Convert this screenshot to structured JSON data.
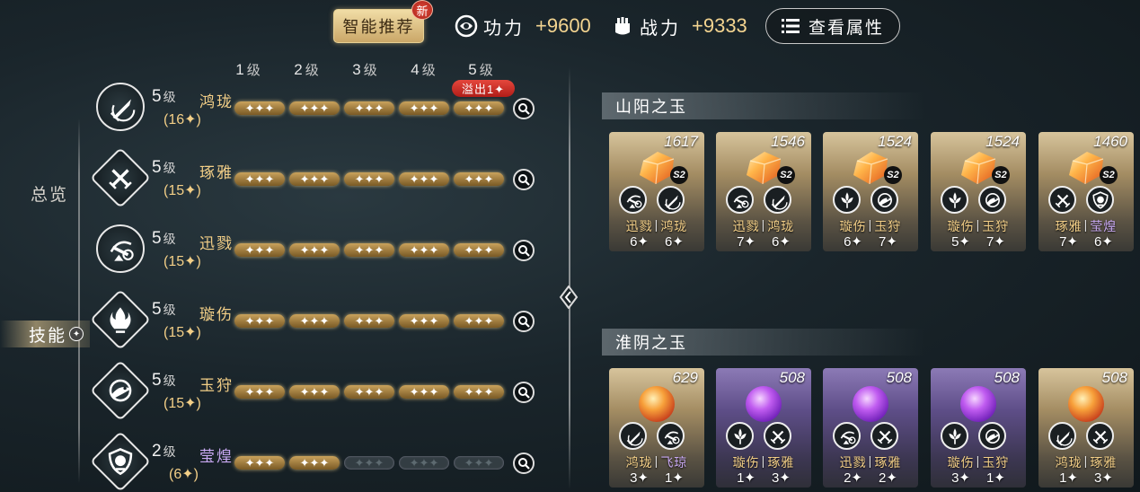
{
  "header": {
    "recommend_label": "智能推荐",
    "new_badge": "新",
    "power_label": "功力",
    "power_value": "+9600",
    "combat_label": "战力",
    "combat_value": "+9333",
    "view_attributes_label": "查看属性"
  },
  "nav": {
    "overview_label": "总览",
    "skills_label": "技能"
  },
  "level_headers": [
    {
      "num": "1",
      "unit": "级"
    },
    {
      "num": "2",
      "unit": "级"
    },
    {
      "num": "3",
      "unit": "级"
    },
    {
      "num": "4",
      "unit": "级"
    },
    {
      "num": "5",
      "unit": "级"
    }
  ],
  "overflow_badge": "溢出1✦",
  "skills": [
    {
      "level": "5",
      "level_unit": "级",
      "name": "鸿珑",
      "points": "(16✦)",
      "filled": 5,
      "color": "gold",
      "icon": "sword-icon"
    },
    {
      "level": "5",
      "level_unit": "级",
      "name": "琢雅",
      "points": "(15✦)",
      "filled": 5,
      "color": "gold",
      "icon": "swords-icon"
    },
    {
      "level": "5",
      "level_unit": "级",
      "name": "迅戮",
      "points": "(15✦)",
      "filled": 5,
      "color": "gold",
      "icon": "dash-icon"
    },
    {
      "level": "5",
      "level_unit": "级",
      "name": "璇伤",
      "points": "(15✦)",
      "filled": 5,
      "color": "gold",
      "icon": "flame-icon"
    },
    {
      "level": "5",
      "level_unit": "级",
      "name": "玉狩",
      "points": "(15✦)",
      "filled": 5,
      "color": "gold",
      "icon": "beast-icon"
    },
    {
      "level": "2",
      "level_unit": "级",
      "name": "莹煌",
      "points": "(6✦)",
      "filled": 2,
      "color": "purple",
      "icon": "shield-icon"
    }
  ],
  "pip_text": "✦✦✦",
  "sections": [
    {
      "title": "山阳之玉",
      "cards": [
        {
          "score": "1617",
          "tier": "gold",
          "gem": "amber",
          "names": [
            "迅戮",
            "鸿珑"
          ],
          "counts": [
            "6✦",
            "6✦"
          ],
          "purple": [
            false,
            false
          ]
        },
        {
          "score": "1546",
          "tier": "gold",
          "gem": "amber",
          "names": [
            "迅戮",
            "鸿珑"
          ],
          "counts": [
            "7✦",
            "6✦"
          ],
          "purple": [
            false,
            false
          ]
        },
        {
          "score": "1524",
          "tier": "gold",
          "gem": "amber",
          "names": [
            "璇伤",
            "玉狩"
          ],
          "counts": [
            "6✦",
            "7✦"
          ],
          "purple": [
            false,
            false
          ]
        },
        {
          "score": "1524",
          "tier": "gold",
          "gem": "amber",
          "names": [
            "璇伤",
            "玉狩"
          ],
          "counts": [
            "5✦",
            "7✦"
          ],
          "purple": [
            false,
            false
          ]
        },
        {
          "score": "1460",
          "tier": "gold",
          "gem": "amber",
          "names": [
            "琢雅",
            "莹煌"
          ],
          "counts": [
            "7✦",
            "6✦"
          ],
          "purple": [
            false,
            true
          ]
        }
      ]
    },
    {
      "title": "淮阴之玉",
      "cards": [
        {
          "score": "629",
          "tier": "gold",
          "gem": "orb-orange",
          "names": [
            "鸿珑",
            "飞琼"
          ],
          "counts": [
            "3✦",
            "1✦"
          ],
          "purple": [
            false,
            true
          ]
        },
        {
          "score": "508",
          "tier": "violet",
          "gem": "orb-purple",
          "names": [
            "璇伤",
            "琢雅"
          ],
          "counts": [
            "1✦",
            "3✦"
          ],
          "purple": [
            false,
            false
          ]
        },
        {
          "score": "508",
          "tier": "violet",
          "gem": "orb-purple",
          "names": [
            "迅戮",
            "琢雅"
          ],
          "counts": [
            "2✦",
            "2✦"
          ],
          "purple": [
            false,
            false
          ]
        },
        {
          "score": "508",
          "tier": "violet",
          "gem": "orb-purple",
          "names": [
            "璇伤",
            "玉狩"
          ],
          "counts": [
            "3✦",
            "1✦"
          ],
          "purple": [
            false,
            false
          ]
        },
        {
          "score": "508",
          "tier": "gold",
          "gem": "orb-orange",
          "names": [
            "鸿珑",
            "琢雅"
          ],
          "counts": [
            "1✦",
            "3✦"
          ],
          "purple": [
            false,
            false
          ]
        }
      ]
    }
  ]
}
